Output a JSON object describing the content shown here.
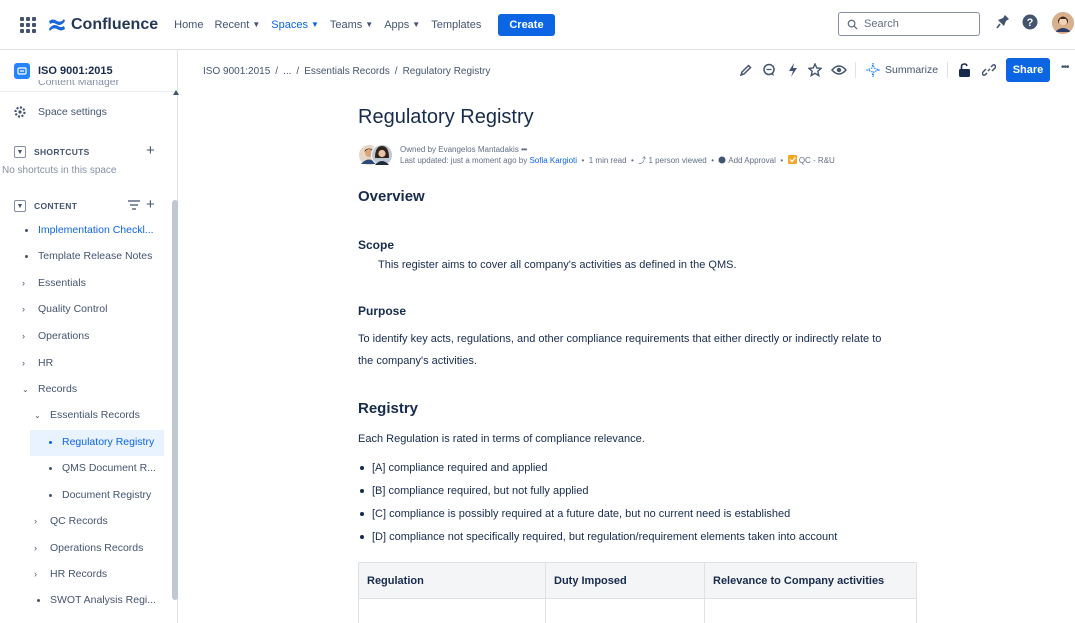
{
  "topnav": {
    "logo_text": "Confluence",
    "items": [
      {
        "label": "Home",
        "has_dropdown": false,
        "active": false
      },
      {
        "label": "Recent",
        "has_dropdown": true,
        "active": false
      },
      {
        "label": "Spaces",
        "has_dropdown": true,
        "active": true
      },
      {
        "label": "Teams",
        "has_dropdown": true,
        "active": false
      },
      {
        "label": "Apps",
        "has_dropdown": true,
        "active": false
      },
      {
        "label": "Templates",
        "has_dropdown": false,
        "active": false
      }
    ],
    "create_label": "Create",
    "search_placeholder": "Search"
  },
  "sidebar": {
    "space_name": "ISO 9001:2015",
    "cut_item": "Content Manager",
    "space_settings": "Space settings",
    "shortcuts_label": "SHORTCUTS",
    "shortcuts_empty": "No shortcuts in this space",
    "content_label": "CONTENT",
    "items": [
      {
        "label": "Implementation Checkl...",
        "kind": "dot"
      },
      {
        "label": "Template Release Notes",
        "kind": "dot"
      },
      {
        "label": "Essentials",
        "kind": "collapsed"
      },
      {
        "label": "Quality Control",
        "kind": "collapsed"
      },
      {
        "label": "Operations",
        "kind": "collapsed"
      },
      {
        "label": "HR",
        "kind": "collapsed"
      },
      {
        "label": "Records",
        "kind": "expanded"
      },
      {
        "label": "Essentials Records",
        "kind": "expanded"
      },
      {
        "label": "Regulatory Registry",
        "kind": "dot"
      },
      {
        "label": "QMS Document R...",
        "kind": "dot"
      },
      {
        "label": "Document Registry",
        "kind": "dot"
      },
      {
        "label": "QC Records",
        "kind": "collapsed"
      },
      {
        "label": "Operations Records",
        "kind": "collapsed"
      },
      {
        "label": "HR Records",
        "kind": "collapsed"
      },
      {
        "label": "SWOT Analysis Regi...",
        "kind": "dot"
      }
    ]
  },
  "breadcrumb": {
    "space": "ISO 9001:2015",
    "ellipsis": "...",
    "parent": "Essentials Records",
    "current": "Regulatory Registry",
    "separator": "/"
  },
  "toolbar": {
    "summarize_label": "Summarize",
    "share_label": "Share",
    "more_label": "•••"
  },
  "page": {
    "title": "Regulatory Registry",
    "owned_by": "Owned by Evangelos Mantadakis",
    "owner_more": "•••",
    "last_updated_prefix": "Last updated: just a moment ago by",
    "last_updated_by": "Sofia Kargioti",
    "read_time": "1 min read",
    "viewed": "1 person viewed",
    "add_approval": "Add Approval",
    "tag": "QC - R&U",
    "overview_heading": "Overview",
    "scope_heading": "Scope",
    "scope_text": "This register aims to cover all company's activities as defined in the QMS.",
    "purpose_heading": "Purpose",
    "purpose_line1": "To identify key acts, regulations, and other compliance requirements that either directly or indirectly relate to",
    "purpose_line2": "the company's activities.",
    "registry_heading": "Registry",
    "registry_intro": "Each Regulation is rated in terms of compliance relevance.",
    "bullets": [
      "[A] compliance required and applied",
      "[B] compliance required, but not fully applied",
      "[C] compliance is possibly required at a future date, but no current need is established",
      "[D] compliance not specifically required, but regulation/requirement elements taken into account"
    ],
    "table_headers": [
      "Regulation",
      "Duty Imposed",
      "Relevance to Company activities"
    ]
  }
}
